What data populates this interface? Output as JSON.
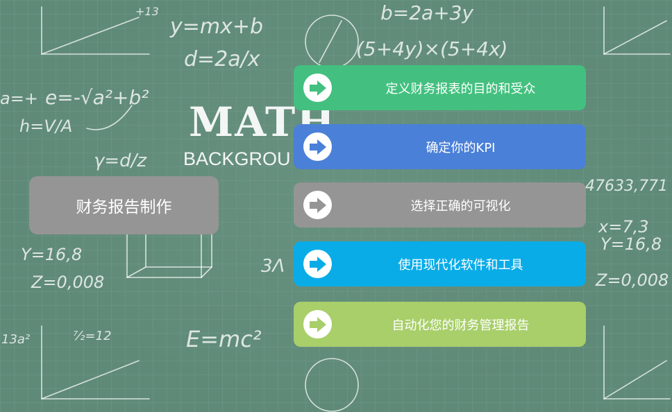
{
  "background": {
    "logo_word": "MATH",
    "logo_sub": "BACKGROU",
    "formulas": [
      "y=mx+b",
      "d=2a/x",
      "b=2a+3y",
      "(5+4y)×(5+4x)",
      "E=mc²",
      "+13",
      "a=+",
      "e=-√a²+b²",
      "h=V/A",
      "γ=d/z",
      "Y=16,8",
      "Z=0,008",
      "Y=16,8",
      "Z=0,008",
      "x=7,3",
      "47633,771",
      "13a²",
      "⁷⁄₂=12",
      "3Λ"
    ]
  },
  "title": {
    "text": "财务报告制作",
    "color": "#959595"
  },
  "steps": [
    {
      "label": "定义财务报表的目的和受众",
      "color": "#43c07f",
      "icon": "arrow-right-icon",
      "arrow_color": "#43c07f"
    },
    {
      "label": "确定你的KPI",
      "color": "#4a80d8",
      "icon": "arrow-right-icon",
      "arrow_color": "#4a80d8"
    },
    {
      "label": "选择正确的可视化",
      "color": "#959595",
      "icon": "arrow-right-icon",
      "arrow_color": "#959595"
    },
    {
      "label": "使用现代化软件和工具",
      "color": "#0aace8",
      "icon": "arrow-right-icon",
      "arrow_color": "#0aace8"
    },
    {
      "label": "自动化您的财务管理报告",
      "color": "#a8cf6a",
      "icon": "arrow-right-icon",
      "arrow_color": "#a8cf6a"
    }
  ]
}
